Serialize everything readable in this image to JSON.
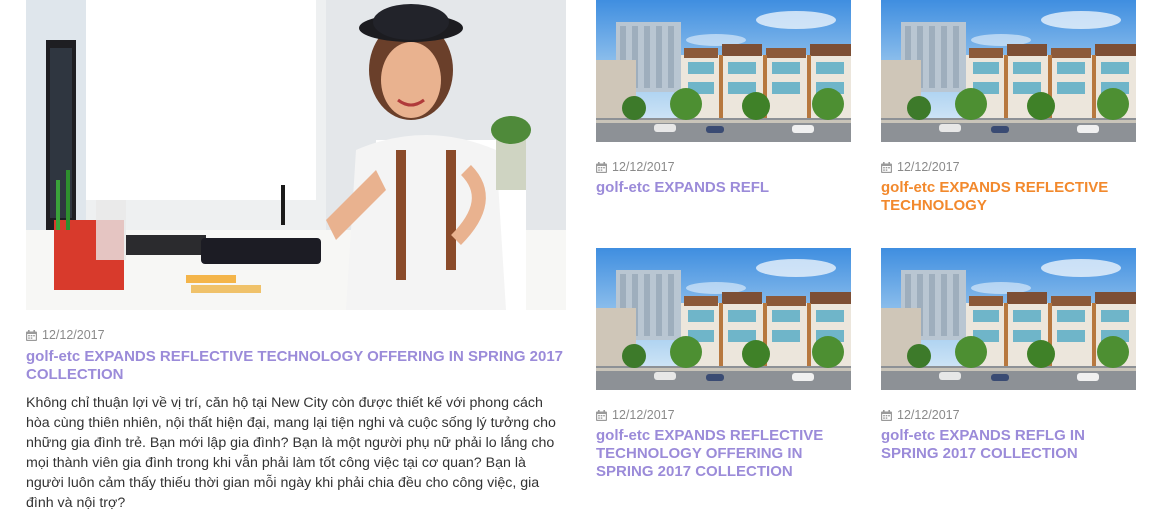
{
  "featured": {
    "date": "12/12/2017",
    "title": "golf-etc EXPANDS REFLECTIVE TECHNOLOGY OFFERING IN SPRING 2017 COLLECTION",
    "excerpt": "Không chỉ thuận lợi về vị trí, căn hộ tại New City còn được thiết kế với phong cách hòa cùng thiên nhiên, nội thất hiện đại, mang lại tiện nghi và cuộc sống lý tưởng cho những gia đình trẻ. Bạn mới lập gia đình? Bạn là một người phụ nữ phải lo lắng cho mọi thành viên gia đình trong khi vẫn phải làm tốt công việc tại cơ quan? Bạn là người luôn cảm thấy thiếu thời gian mỗi ngày khi phải chia đều cho công việc, gia đình và nội trợ?",
    "image": "woman-at-desk-photo"
  },
  "cards": [
    {
      "date": "12/12/2017",
      "title": "golf-etc EXPANDS REFL",
      "title_color": "#9b8bd9",
      "image": "townhouse-rendering"
    },
    {
      "date": "12/12/2017",
      "title": "golf-etc EXPANDS REFLECTIVE TECHNOLOGY",
      "title_color": "#f2892d",
      "image": "townhouse-rendering"
    },
    {
      "date": "12/12/2017",
      "title": "golf-etc EXPANDS REFLECTIVE TECHNOLOGY OFFERING IN SPRING 2017 COLLECTION",
      "title_color": "#9b8bd9",
      "image": "townhouse-rendering"
    },
    {
      "date": "12/12/2017",
      "title": "golf-etc EXPANDS REFLG IN SPRING 2017 COLLECTION",
      "title_color": "#9b8bd9",
      "image": "townhouse-rendering"
    }
  ],
  "colors": {
    "title_purple": "#9b8bd9",
    "title_orange": "#f2892d",
    "date_gray": "#8a8a8a",
    "text": "#333333"
  },
  "icons": {
    "date": "calendar-icon"
  }
}
